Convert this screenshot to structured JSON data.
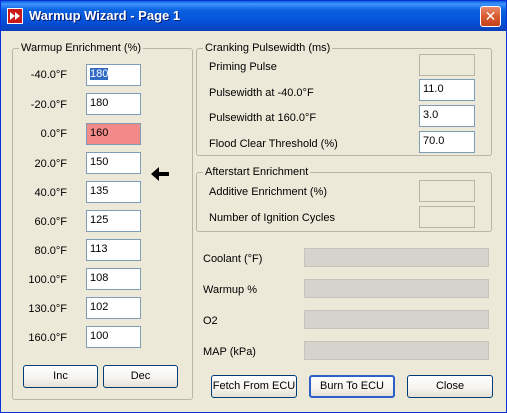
{
  "window": {
    "title": "Warmup Wizard - Page 1",
    "close_glyph": "✕"
  },
  "warmup": {
    "label": "Warmup Enrichment (%)",
    "rows": [
      {
        "temp": "-40.0°F",
        "value": "180",
        "state": "selected"
      },
      {
        "temp": "-20.0°F",
        "value": "180",
        "state": "normal"
      },
      {
        "temp": "0.0°F",
        "value": "160",
        "state": "highlight"
      },
      {
        "temp": "20.0°F",
        "value": "150",
        "state": "normal"
      },
      {
        "temp": "40.0°F",
        "value": "135",
        "state": "normal"
      },
      {
        "temp": "60.0°F",
        "value": "125",
        "state": "normal"
      },
      {
        "temp": "80.0°F",
        "value": "113",
        "state": "normal"
      },
      {
        "temp": "100.0°F",
        "value": "108",
        "state": "normal"
      },
      {
        "temp": "130.0°F",
        "value": "102",
        "state": "normal"
      },
      {
        "temp": "160.0°F",
        "value": "100",
        "state": "normal"
      }
    ],
    "cursor_icon": "arrow-left-icon",
    "inc_label": "Inc",
    "dec_label": "Dec"
  },
  "cranking": {
    "label": "Cranking Pulsewidth (ms)",
    "priming_label": "Priming Pulse",
    "priming_value": "",
    "pw_minus40_label": "Pulsewidth at -40.0°F",
    "pw_minus40_value": "11.0",
    "pw_160_label": "Pulsewidth at 160.0°F",
    "pw_160_value": "3.0",
    "flood_label": "Flood Clear Threshold (%)",
    "flood_value": "70.0"
  },
  "afterstart": {
    "label": "Afterstart Enrichment",
    "additive_label": "Additive Enrichment (%)",
    "additive_value": "",
    "cycles_label": "Number of Ignition Cycles",
    "cycles_value": ""
  },
  "gauges": {
    "coolant_label": "Coolant (°F)",
    "warmup_label": "Warmup %",
    "o2_label": "O2",
    "map_label": "MAP (kPa)"
  },
  "buttons": {
    "fetch_label": "Fetch From ECU",
    "burn_label": "Burn To ECU",
    "close_label": "Close"
  },
  "colors": {
    "title_bar": "#0550d8",
    "selection": "#316ac5",
    "highlight_field": "#f28a8a"
  }
}
